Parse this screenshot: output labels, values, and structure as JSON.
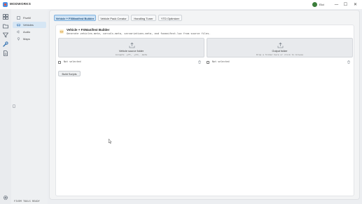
{
  "app": {
    "name": "MODWORKS"
  },
  "user": {
    "name": "Eloi"
  },
  "window_controls": {
    "minimize": "—",
    "maximize": "☐",
    "close": "✕"
  },
  "sidebar": {
    "items": [
      {
        "label": "FiveM",
        "icon": "cube-icon"
      },
      {
        "label": "Vehicles",
        "icon": "car-icon",
        "active": true
      },
      {
        "label": "Audio",
        "icon": "speaker-icon"
      },
      {
        "label": "Maps",
        "icon": "pin-icon"
      }
    ],
    "collapse_glyph": "‹"
  },
  "tabs": [
    {
      "label": "Vehicle + FXManifest Builder",
      "active": true
    },
    {
      "label": "Vehicle Pack Creator"
    },
    {
      "label": "Handling Tuner"
    },
    {
      "label": "YTD Optimizer"
    }
  ],
  "builder": {
    "title": "Vehicle + FXManifest Builder",
    "subtitle": "Generate vehicles.meta, carcols.meta, carvariations.meta, and fxmanifest.lua from source files.",
    "source": {
      "title": "Vehicle source folder",
      "hint": "Accepts .yft, .ytd, .meta",
      "status": "Not selected"
    },
    "output": {
      "title": "Output folder",
      "hint": "Drop a folder here or click to browse",
      "status": "Not selected"
    },
    "build_button": "Build Scripts"
  },
  "footer": {
    "status": "FIVEM TOOLS READY"
  },
  "colors": {
    "accent": "#7fb2e0",
    "active_tab_bg": "#cfe3f5",
    "avatar": "#3b7d3b",
    "logo": "#4a90e2"
  }
}
